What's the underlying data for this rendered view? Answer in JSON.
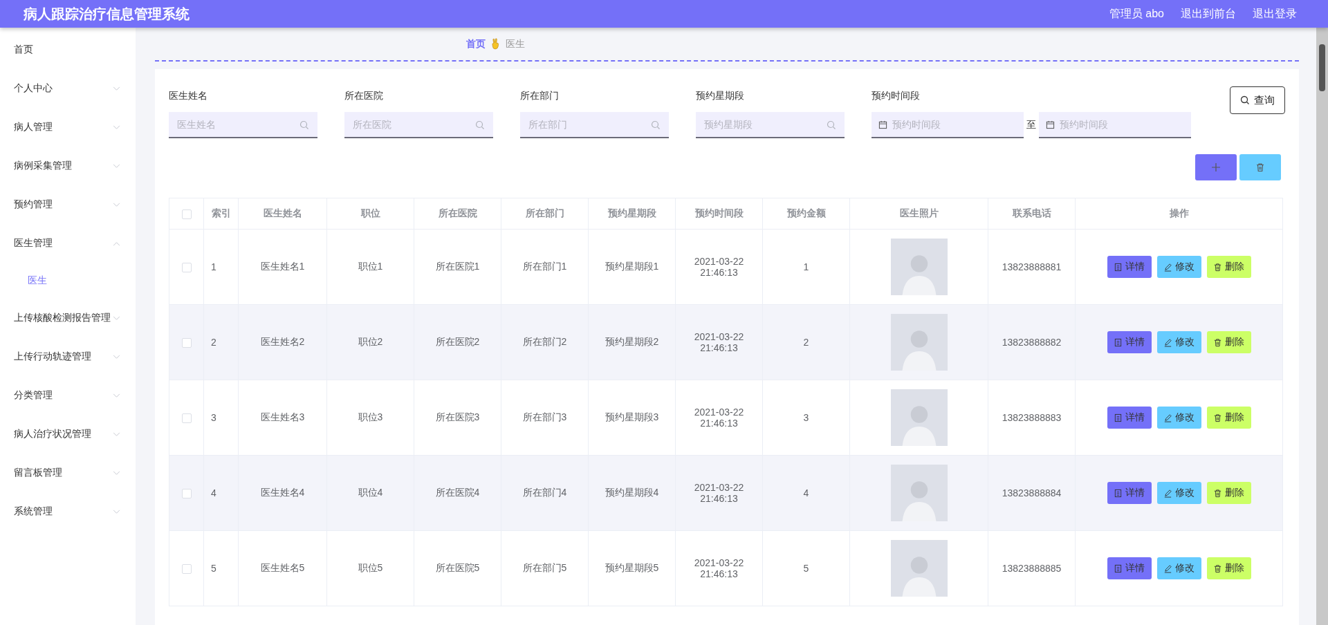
{
  "header": {
    "title": "病人跟踪治疗信息管理系统",
    "user": "管理员 abo",
    "links": [
      "退出到前台",
      "退出登录"
    ]
  },
  "sidebar": {
    "items": [
      {
        "label": "首页",
        "kind": "link"
      },
      {
        "label": "个人中心",
        "kind": "menu",
        "expanded": false
      },
      {
        "label": "病人管理",
        "kind": "menu",
        "expanded": false
      },
      {
        "label": "病例采集管理",
        "kind": "menu",
        "expanded": false
      },
      {
        "label": "预约管理",
        "kind": "menu",
        "expanded": false
      },
      {
        "label": "医生管理",
        "kind": "menu",
        "expanded": true,
        "children": [
          {
            "label": "医生",
            "selected": true
          }
        ]
      },
      {
        "label": "上传核酸检测报告管理",
        "kind": "menu",
        "expanded": false
      },
      {
        "label": "上传行动轨迹管理",
        "kind": "menu",
        "expanded": false
      },
      {
        "label": "分类管理",
        "kind": "menu",
        "expanded": false
      },
      {
        "label": "病人治疗状况管理",
        "kind": "menu",
        "expanded": false
      },
      {
        "label": "留言板管理",
        "kind": "menu",
        "expanded": false
      },
      {
        "label": "系统管理",
        "kind": "menu",
        "expanded": false
      }
    ]
  },
  "breadcrumb": [
    {
      "label": "首页",
      "selected": false
    },
    {
      "label": "医生",
      "selected": true
    }
  ],
  "filters": [
    {
      "kind": "search",
      "label": "医生姓名",
      "placeholder": "医生姓名"
    },
    {
      "kind": "search",
      "label": "所在医院",
      "placeholder": "所在医院"
    },
    {
      "kind": "search",
      "label": "所在部门",
      "placeholder": "所在部门"
    },
    {
      "kind": "search",
      "label": "预约星期段",
      "placeholder": "预约星期段"
    },
    {
      "kind": "daterange",
      "label": "预约时间段",
      "placeholders": [
        "预约时间段",
        "预约时间段"
      ],
      "separator": "至"
    }
  ],
  "search_button": "查询",
  "table": {
    "all_checked": false,
    "columns": [
      "索引",
      "医生姓名",
      "职位",
      "所在医院",
      "所在部门",
      "预约星期段",
      "预约时间段",
      "预约金额",
      "医生照片",
      "联系电话",
      "操作"
    ],
    "rows": [
      {
        "checked": false,
        "index": "1",
        "name": "医生姓名1",
        "position": "职位1",
        "hospital": "所在医院1",
        "department": "所在部门1",
        "weekday": "预约星期段1",
        "time": "2021-03-22 21:46:13",
        "amount": "1",
        "phone": "13823888881",
        "actions": [
          "详情",
          "修改",
          "删除"
        ]
      },
      {
        "checked": false,
        "index": "2",
        "name": "医生姓名2",
        "position": "职位2",
        "hospital": "所在医院2",
        "department": "所在部门2",
        "weekday": "预约星期段2",
        "time": "2021-03-22 21:46:13",
        "amount": "2",
        "phone": "13823888882",
        "actions": [
          "详情",
          "修改",
          "删除"
        ]
      },
      {
        "checked": false,
        "index": "3",
        "name": "医生姓名3",
        "position": "职位3",
        "hospital": "所在医院3",
        "department": "所在部门3",
        "weekday": "预约星期段3",
        "time": "2021-03-22 21:46:13",
        "amount": "3",
        "phone": "13823888883",
        "actions": [
          "详情",
          "修改",
          "删除"
        ]
      },
      {
        "checked": false,
        "index": "4",
        "name": "医生姓名4",
        "position": "职位4",
        "hospital": "所在医院4",
        "department": "所在部门4",
        "weekday": "预约星期段4",
        "time": "2021-03-22 21:46:13",
        "amount": "4",
        "phone": "13823888884",
        "actions": [
          "详情",
          "修改",
          "删除"
        ]
      },
      {
        "checked": false,
        "index": "5",
        "name": "医生姓名5",
        "position": "职位5",
        "hospital": "所在医院5",
        "department": "所在部门5",
        "weekday": "预约星期段5",
        "time": "2021-03-22 21:46:13",
        "amount": "5",
        "phone": "13823888885",
        "actions": [
          "详情",
          "修改",
          "删除"
        ]
      }
    ]
  }
}
